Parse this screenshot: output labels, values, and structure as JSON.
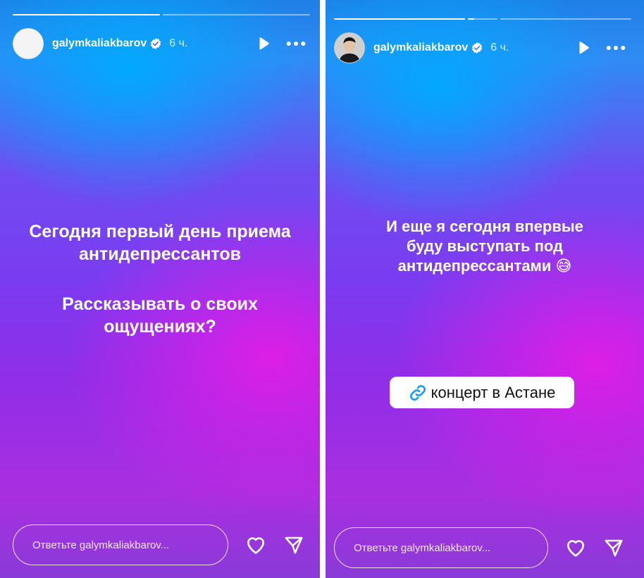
{
  "stories": [
    {
      "username": "galymkaliakbarov",
      "time": "6 ч.",
      "progress": [
        1.0,
        0.0
      ],
      "text_block_1": [
        "Сегодня первый день приема",
        "антидепрессантов"
      ],
      "text_block_2": [
        "Рассказывать о своих",
        "ощущениях?"
      ],
      "reply_placeholder": "Ответьте galymkaliakbarov..."
    },
    {
      "username": "galymkaliakbarov",
      "time": "6 ч.",
      "progress": [
        1.0,
        0.2,
        0.0
      ],
      "text_lines": [
        "И еще я сегодня впервые",
        "буду выступать под",
        "антидепрессантами 😅"
      ],
      "link_label": "концерт в Астане",
      "reply_placeholder": "Ответьте galymkaliakbarov..."
    }
  ],
  "icons": {
    "verified": "verified-badge-icon",
    "play": "play-icon",
    "more": "more-dots-icon",
    "like": "heart-icon",
    "share": "send-icon",
    "link": "link-icon"
  },
  "colors": {
    "accent_link": "#1a9bf0",
    "verified_badge": "#ffffff"
  }
}
